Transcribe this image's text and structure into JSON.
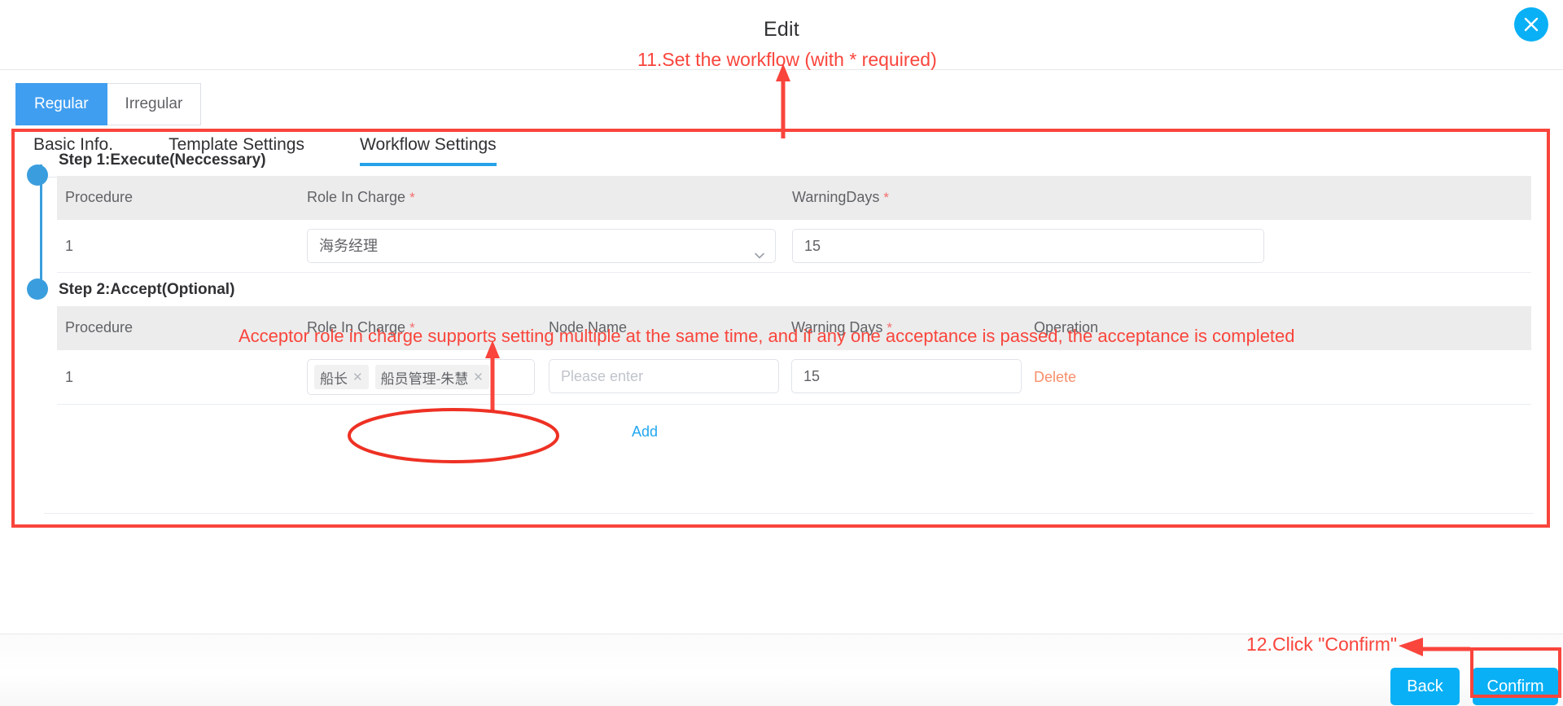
{
  "dialog": {
    "title": "Edit",
    "close_icon": "close-icon"
  },
  "type_tabs": [
    {
      "label": "Regular",
      "active": true
    },
    {
      "label": "Irregular",
      "active": false
    }
  ],
  "panel_tabs": [
    {
      "label": "Basic Info.",
      "active": false
    },
    {
      "label": "Template Settings",
      "active": false
    },
    {
      "label": "Workflow Settings",
      "active": true
    }
  ],
  "step1": {
    "title": "Step 1:Execute(Neccessary)",
    "columns": [
      "Procedure",
      "Role In Charge",
      "WarningDays"
    ],
    "required_flags": [
      false,
      true,
      true
    ],
    "row": {
      "procedure": "1",
      "role_in_charge": "海务经理",
      "role_dropdown_icon": "chevron-down-icon",
      "warning_days": "15"
    }
  },
  "step2": {
    "title": "Step 2:Accept(Optional)",
    "columns": [
      "Procedure",
      "Role In Charge",
      "Node Name",
      "Warning Days",
      "Operation"
    ],
    "required_flags": [
      false,
      true,
      false,
      true,
      false
    ],
    "row": {
      "procedure": "1",
      "role_tags": [
        "船长",
        "船员管理-朱慧"
      ],
      "tag_remove_icon": "close-small-icon",
      "node_name_value": "",
      "node_name_placeholder": "Please enter",
      "warning_days": "15",
      "operation_label": "Delete"
    },
    "add_label": "Add"
  },
  "footer": {
    "back_label": "Back",
    "confirm_label": "Confirm"
  },
  "annotations": {
    "step_note_11": "11.Set the workflow (with * required)",
    "acceptor_note": "Acceptor role in charge supports setting multiple at the same time, and if any one acceptance is passed, the acceptance is completed",
    "confirm_note": "12.Click \"Confirm\"",
    "color": "#f9453c"
  },
  "colors": {
    "primary_blue": "#0ab0f5",
    "tab_blue": "#409ef0",
    "underline_blue": "#26a2e8",
    "timeline_blue": "#3a9ede",
    "link_blue": "#22a7f0",
    "delete_orange": "#f78f6b",
    "required_red": "#f56c6c",
    "annotation_red": "#f9453c",
    "header_grey": "#ececec"
  }
}
